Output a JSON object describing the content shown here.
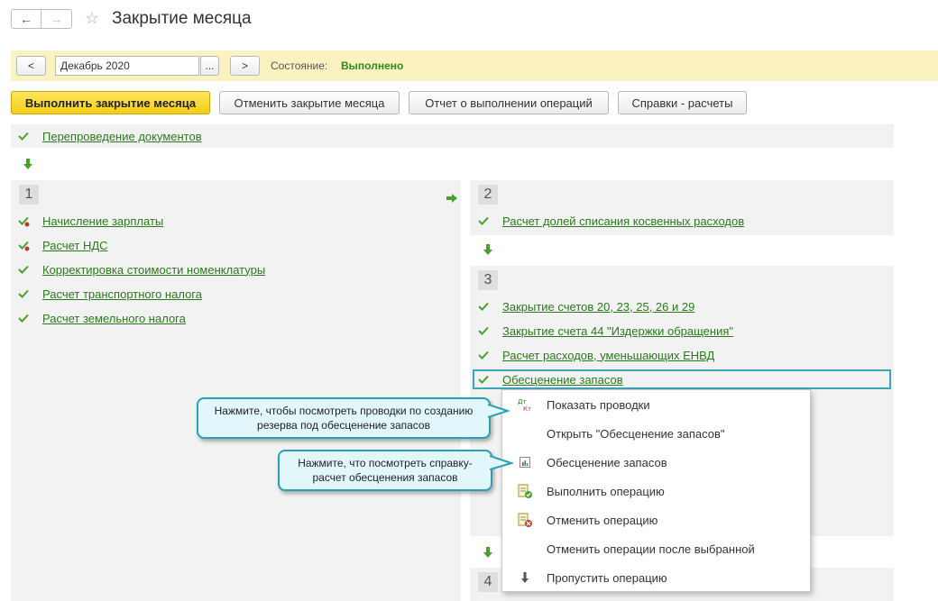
{
  "window": {
    "title": "Закрытие месяца",
    "back_icon": "←",
    "forward_icon": "→",
    "favorite_icon": "☆"
  },
  "status_bar": {
    "prev_label": "<",
    "next_label": ">",
    "period_value": "Декабрь 2020",
    "period_select_label": "...",
    "state_label": "Состояние:",
    "state_value": "Выполнено"
  },
  "toolbar": {
    "execute_label": "Выполнить закрытие месяца",
    "cancel_label": "Отменить закрытие месяца",
    "report_label": "Отчет о выполнении операций",
    "calculations_label": "Справки - расчеты"
  },
  "pre_step": {
    "label": "Перепроведение документов"
  },
  "stage1": {
    "number": "1",
    "items": [
      {
        "label": "Начисление зарплаты"
      },
      {
        "label": "Расчет НДС"
      },
      {
        "label": "Корректировка стоимости номенклатуры"
      },
      {
        "label": "Расчет транспортного налога"
      },
      {
        "label": "Расчет земельного налога"
      }
    ]
  },
  "stage2": {
    "number": "2",
    "items": [
      {
        "label": "Расчет долей списания косвенных расходов"
      }
    ]
  },
  "stage3": {
    "number": "3",
    "items": [
      {
        "label": "Закрытие счетов 20, 23, 25, 26 и 29"
      },
      {
        "label": "Закрытие счета 44 \"Издержки обращения\""
      },
      {
        "label": "Расчет расходов, уменьшающих ЕНВД"
      },
      {
        "label": "Обесценение запасов"
      }
    ]
  },
  "stage4": {
    "number": "4"
  },
  "context_menu": {
    "items": [
      {
        "label": "Показать проводки",
        "icon": "dt-kt-icon"
      },
      {
        "label": "Открыть \"Обесценение запасов\"",
        "icon": ""
      },
      {
        "label": "Обесценение запасов",
        "icon": "report-icon"
      },
      {
        "label": "Выполнить операцию",
        "icon": "execute-icon"
      },
      {
        "label": "Отменить операцию",
        "icon": "cancel-operation-icon"
      },
      {
        "label": "Отменить операции после выбранной",
        "icon": ""
      },
      {
        "label": "Пропустить операцию",
        "icon": "skip-arrow-icon"
      }
    ],
    "dt_text": "Дт",
    "kt_text": "Кт"
  },
  "callouts": {
    "postings_hint": "Нажмите, чтобы посмотреть проводки по созданию резерва под обесценение запасов",
    "report_hint": "Нажмите, что посмотреть справку-расчет обесценения запасов"
  },
  "colors": {
    "link_green": "#2a7a1c",
    "status_bar_yellow": "#fbf2c2",
    "primary_yellow": "#f4ce14",
    "callout_border": "#2d9fb3",
    "callout_fill": "#e1f7fb",
    "check_green": "#4aa02c"
  }
}
